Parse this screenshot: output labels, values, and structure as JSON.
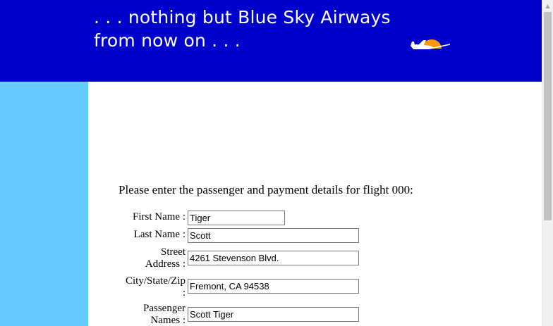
{
  "header": {
    "tagline_line1": ". . . nothing but Blue Sky Airways",
    "tagline_line2": "from now on . . .",
    "logo_icon": "plane-sunset-logo-icon",
    "colors": {
      "header_bg": "#0000cc",
      "sidebar_bg": "#66ccff",
      "sun": "#ff9900"
    }
  },
  "form": {
    "intro": "Please enter the passenger and payment details for flight 000:",
    "fields": [
      {
        "label": "First Name :",
        "value": "Tiger"
      },
      {
        "label": "Last Name :",
        "value": "Scott"
      },
      {
        "label_line1": "Street",
        "label_line2": "Address :",
        "value": "4261 Stevenson Blvd."
      },
      {
        "label_line1": "City/State/Zip",
        "label_line2": ":",
        "value": "Fremont, CA 94538"
      },
      {
        "label_line1": "Passenger",
        "label_line2": "Names :",
        "value": "Scott Tiger"
      }
    ]
  },
  "scrollbar": {
    "up_arrow_icon": "scroll-up-arrow-icon"
  }
}
